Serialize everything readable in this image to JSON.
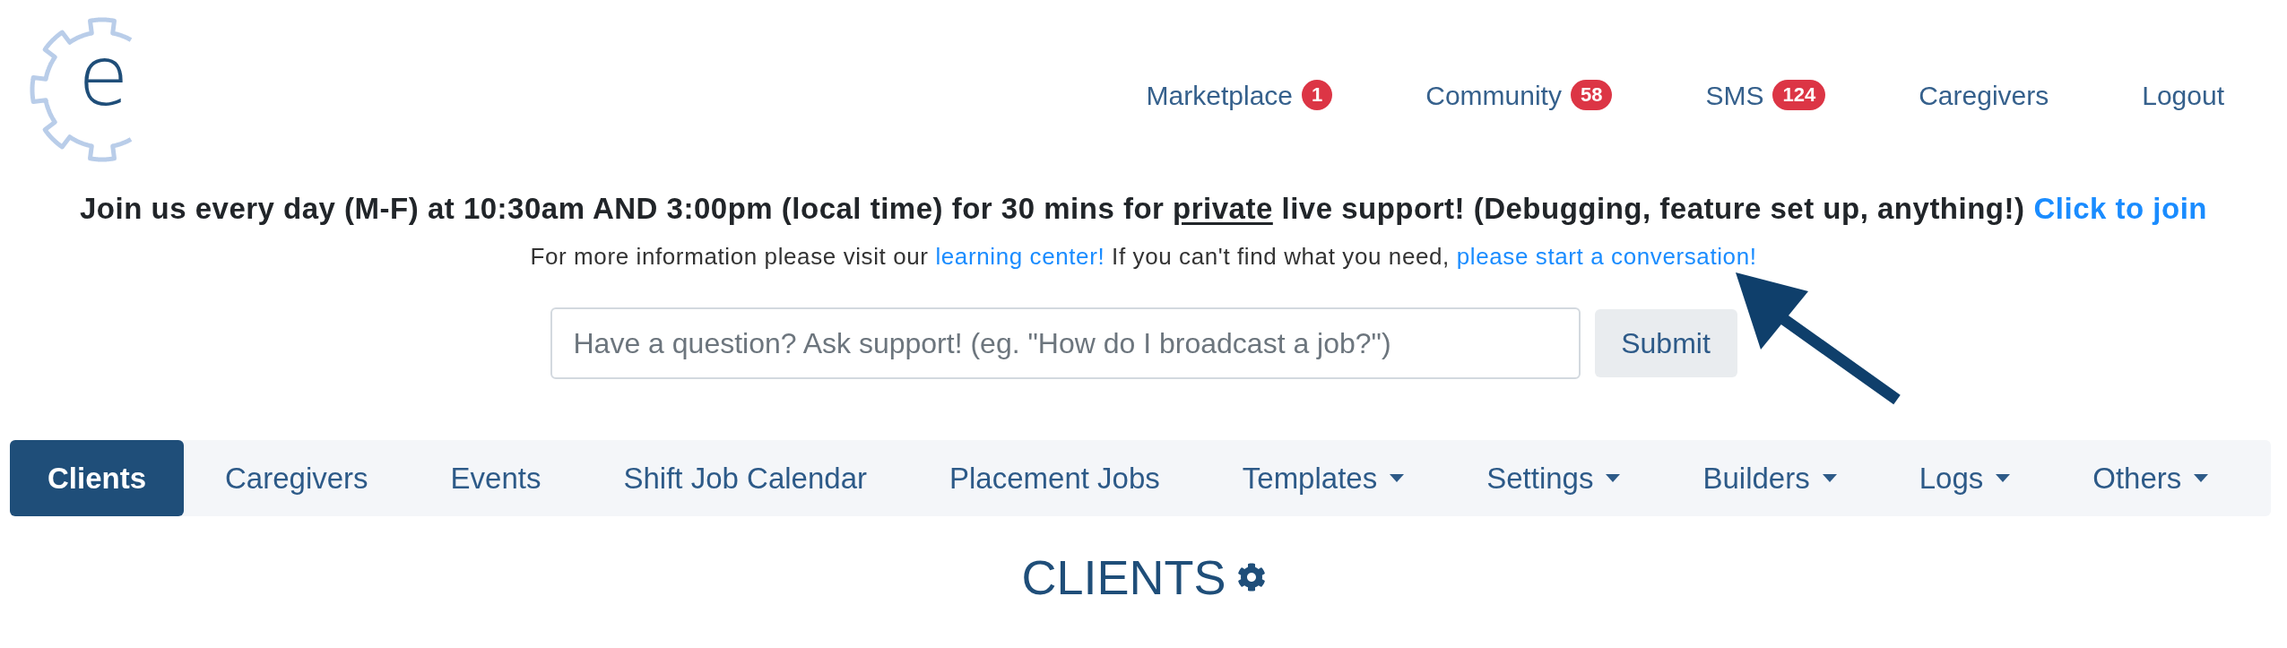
{
  "logo": {
    "letter": "e"
  },
  "nav": [
    {
      "label": "Marketplace",
      "badge": "1"
    },
    {
      "label": "Community",
      "badge": "58"
    },
    {
      "label": "SMS",
      "badge": "124"
    },
    {
      "label": "Caregivers"
    },
    {
      "label": "Logout"
    }
  ],
  "announcement": {
    "parts": [
      {
        "kind": "text",
        "text": "Join us every day (M-F) at 10:30am AND 3:00pm (local time) for 30 mins for "
      },
      {
        "kind": "underline",
        "text": "private"
      },
      {
        "kind": "text",
        "text": " live support! (Debugging, feature set up, anything!)"
      }
    ],
    "link": "Click to join"
  },
  "help": {
    "parts": [
      {
        "kind": "text",
        "text": "For more information please visit our "
      },
      {
        "kind": "link",
        "text": "learning center!"
      },
      {
        "kind": "text",
        "text": " If you can't find what you need, "
      },
      {
        "kind": "link",
        "text": "please start a conversation!"
      }
    ]
  },
  "search": {
    "placeholder": "Have a question? Ask support! (eg. \"How do I broadcast a job?\")",
    "button": "Submit"
  },
  "tabs": [
    {
      "label": "Clients",
      "selected": true,
      "dropdown": false
    },
    {
      "label": "Caregivers",
      "selected": false,
      "dropdown": false
    },
    {
      "label": "Events",
      "selected": false,
      "dropdown": false
    },
    {
      "label": "Shift Job Calendar",
      "selected": false,
      "dropdown": false
    },
    {
      "label": "Placement Jobs",
      "selected": false,
      "dropdown": false
    },
    {
      "label": "Templates",
      "selected": false,
      "dropdown": true
    },
    {
      "label": "Settings",
      "selected": false,
      "dropdown": true
    },
    {
      "label": "Builders",
      "selected": false,
      "dropdown": true
    },
    {
      "label": "Logs",
      "selected": false,
      "dropdown": true
    },
    {
      "label": "Others",
      "selected": false,
      "dropdown": true
    }
  ],
  "heading": {
    "text": "CLIENTS"
  }
}
